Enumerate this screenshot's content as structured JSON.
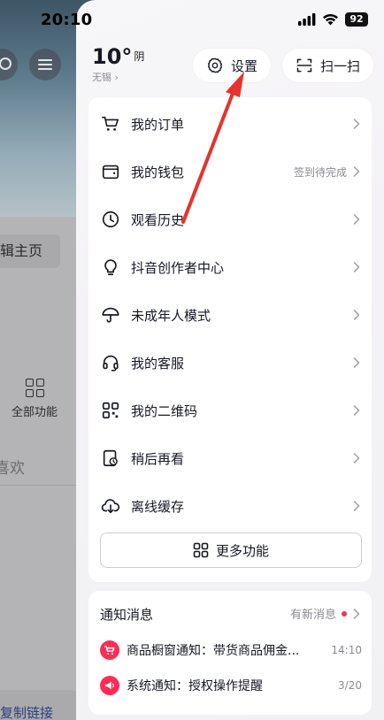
{
  "status_bar": {
    "time": "20:10",
    "battery": "92"
  },
  "background_page": {
    "chip_label": "辑主页",
    "all_functions": "全部功能",
    "like_text": "喜欢",
    "copy_link": "复制链接"
  },
  "weather": {
    "temperature": "10°",
    "condition": "阴",
    "city": "无锡 ›"
  },
  "header_buttons": {
    "settings": "设置",
    "scan": "扫一扫"
  },
  "menu": {
    "items": [
      {
        "label": "我的订单",
        "icon": "cart-icon",
        "extra": ""
      },
      {
        "label": "我的钱包",
        "icon": "wallet-icon",
        "extra": "签到待完成"
      },
      {
        "label": "观看历史",
        "icon": "clock-icon",
        "extra": ""
      },
      {
        "label": "抖音创作者中心",
        "icon": "bulb-icon",
        "extra": ""
      },
      {
        "label": "未成年人模式",
        "icon": "umbrella-icon",
        "extra": ""
      },
      {
        "label": "我的客服",
        "icon": "headset-icon",
        "extra": ""
      },
      {
        "label": "我的二维码",
        "icon": "qrcode-icon",
        "extra": ""
      },
      {
        "label": "稍后再看",
        "icon": "watch-later-icon",
        "extra": ""
      },
      {
        "label": "离线缓存",
        "icon": "cloud-download-icon",
        "extra": ""
      }
    ],
    "more_button": "更多功能"
  },
  "notices": {
    "title": "通知消息",
    "status": "有新消息",
    "items": [
      {
        "text": "商品橱窗通知：带货商品佣金...",
        "time": "14:10",
        "icon": "shop-cart-icon",
        "color": "#fe2c55"
      },
      {
        "text": "系统通知：授权操作提醒",
        "time": "3/20",
        "icon": "megaphone-icon",
        "color": "#fe2c55"
      }
    ]
  },
  "colors": {
    "accent": "#fe2c55",
    "annotation_arrow": "#e8322b"
  }
}
